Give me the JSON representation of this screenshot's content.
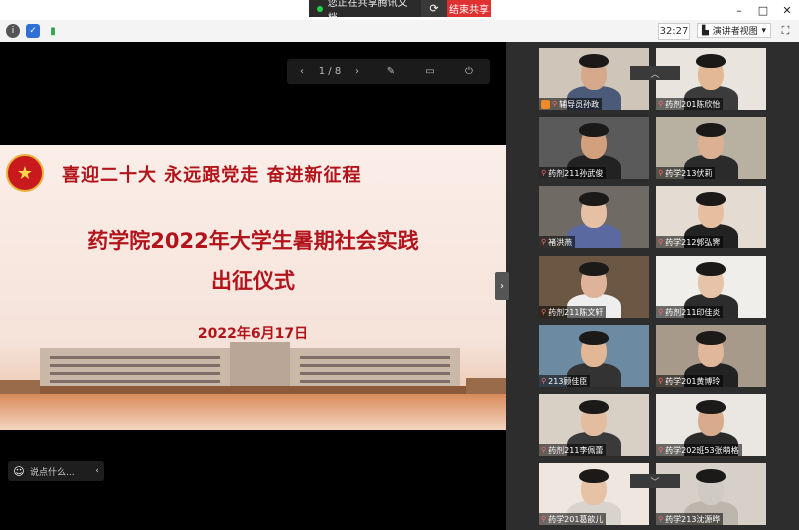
{
  "share_bar": {
    "status": "您正在共享腾讯文档",
    "stop_label": "结束共享",
    "refresh_icon": "refresh-icon"
  },
  "window": {
    "minimize": "–",
    "maximize": "□",
    "close": "✕"
  },
  "toolbar": {
    "info": "i",
    "shield": "✓",
    "signal": "▮",
    "timer": "32:27",
    "view_label": "演讲者视图",
    "view_arrow": "▾",
    "fullscreen": "⛶"
  },
  "slide_nav": {
    "prev": "‹",
    "page": "1 / 8",
    "next": "›",
    "pen": "✎",
    "window": "▭",
    "exit": "⏻"
  },
  "slide": {
    "slogan": "喜迎二十大   永远跟党走   奋进新征程",
    "title_line1": "药学院2022年大学生暑期社会实践",
    "title_line2": "出征仪式",
    "date": "2022年6月17日"
  },
  "comment": {
    "emoji": "☺",
    "placeholder": "说点什么...",
    "collapse": "‹"
  },
  "participants": [
    {
      "name": "辅导员孙政",
      "bg": "#cfc6b9",
      "face": "#d7a98c",
      "shirt": "#4b5a78",
      "host": true
    },
    {
      "name": "药剂201陈欣怡",
      "bg": "#e9e4dd",
      "face": "#e3b896",
      "shirt": "#3b3b3b"
    },
    {
      "name": "药剂211孙武俊",
      "bg": "#5a5a5a",
      "face": "#d2a07c",
      "shirt": "#222"
    },
    {
      "name": "药学213伏莉",
      "bg": "#b8b1a2",
      "face": "#dcb092",
      "shirt": "#2b2b2b"
    },
    {
      "name": "褚洪燕",
      "bg": "#6f6a63",
      "face": "#e5c0a4",
      "shirt": "#5a6aa0"
    },
    {
      "name": "药学212郭弘霁",
      "bg": "#e4dcd2",
      "face": "#e6bea0",
      "shirt": "#222"
    },
    {
      "name": "药剂211陈文轩",
      "bg": "#6b5744",
      "face": "#dfb39a",
      "shirt": "#eee"
    },
    {
      "name": "药剂211印佳炎",
      "bg": "#f0eeea",
      "face": "#e6c4aa",
      "shirt": "#2c2c2c"
    },
    {
      "name": "213顾佳臣",
      "bg": "#6d8aa3",
      "face": "#e2b796",
      "shirt": "#333"
    },
    {
      "name": "药学201黄博玲",
      "bg": "#a89a8b",
      "face": "#e1b79b",
      "shirt": "#222"
    },
    {
      "name": "药剂211李佩蕾",
      "bg": "#d8cfc5",
      "face": "#e4bca0",
      "shirt": "#3a3a3a"
    },
    {
      "name": "药学202班53张萌格",
      "bg": "#eae6e1",
      "face": "#d9ab8d",
      "shirt": "#2a2a2a"
    },
    {
      "name": "药学201葛歆儿",
      "bg": "#efe7df",
      "face": "#e6c2a7",
      "shirt": "#d9d3cd"
    },
    {
      "name": "药学213沈源晔",
      "bg": "#d6d0c8",
      "face": "#cfcac4",
      "shirt": "#bdb6ad"
    }
  ],
  "sidebar_scroll": {
    "up": "︿",
    "down": "﹀"
  },
  "colors": {
    "accent_red": "#b3141b",
    "stop_red": "#e03131",
    "sidebar_bg": "#2d2d2d"
  }
}
